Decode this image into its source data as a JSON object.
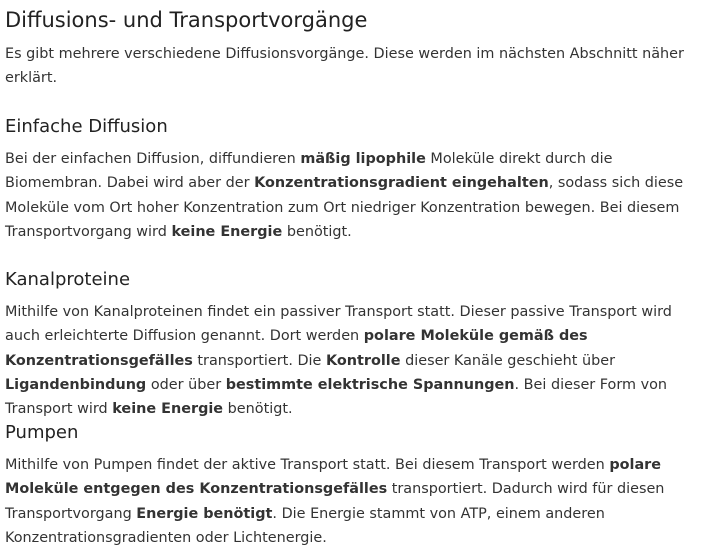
{
  "title": "Diffusions- und Transportvorgänge",
  "intro": "Es gibt mehrere verschiedene Diffusionsvorgänge. Diese werden im nächsten Abschnitt näher erklärt.",
  "sections": [
    {
      "heading": "Einfache Diffusion",
      "segments": [
        {
          "t": "Bei der einfachen Diffusion, diffundieren "
        },
        {
          "t": "mäßig lipophile",
          "b": true
        },
        {
          "t": " Moleküle direkt durch die Biomembran. Dabei wird aber der "
        },
        {
          "t": "Konzentrationsgradient eingehalten",
          "b": true
        },
        {
          "t": ", sodass sich diese Moleküle vom Ort hoher Konzentration zum Ort niedriger Konzentration bewegen. Bei diesem Transportvorgang wird "
        },
        {
          "t": "keine Energie",
          "b": true
        },
        {
          "t": " benötigt."
        }
      ]
    },
    {
      "heading": "Kanalproteine",
      "segments": [
        {
          "t": "Mithilfe von Kanalproteinen findet ein passiver Transport statt. Dieser passive Transport wird auch erleichterte Diffusion genannt. Dort werden "
        },
        {
          "t": "polare Moleküle gemäß des Konzentrationsgefälles",
          "b": true
        },
        {
          "t": " transportiert. Die "
        },
        {
          "t": "Kontrolle",
          "b": true
        },
        {
          "t": " dieser Kanäle geschieht über "
        },
        {
          "t": "Ligandenbindung",
          "b": true
        },
        {
          "t": " oder über "
        },
        {
          "t": "bestimmte elektrische Spannungen",
          "b": true
        },
        {
          "t": ". Bei dieser Form von Transport wird "
        },
        {
          "t": "keine Energie",
          "b": true
        },
        {
          "t": " benötigt."
        }
      ]
    },
    {
      "heading": "Pumpen",
      "segments": [
        {
          "t": "Mithilfe von Pumpen findet der aktive Transport statt. Bei diesem Transport werden "
        },
        {
          "t": "polare Moleküle entgegen des Konzentrationsgefälles",
          "b": true
        },
        {
          "t": " transportiert. Dadurch wird für diesen Transportvorgang "
        },
        {
          "t": "Energie benötigt",
          "b": true
        },
        {
          "t": ". Die Energie stammt von ATP, einem anderen Konzentrationsgradienten oder Lichtenergie."
        }
      ]
    }
  ]
}
